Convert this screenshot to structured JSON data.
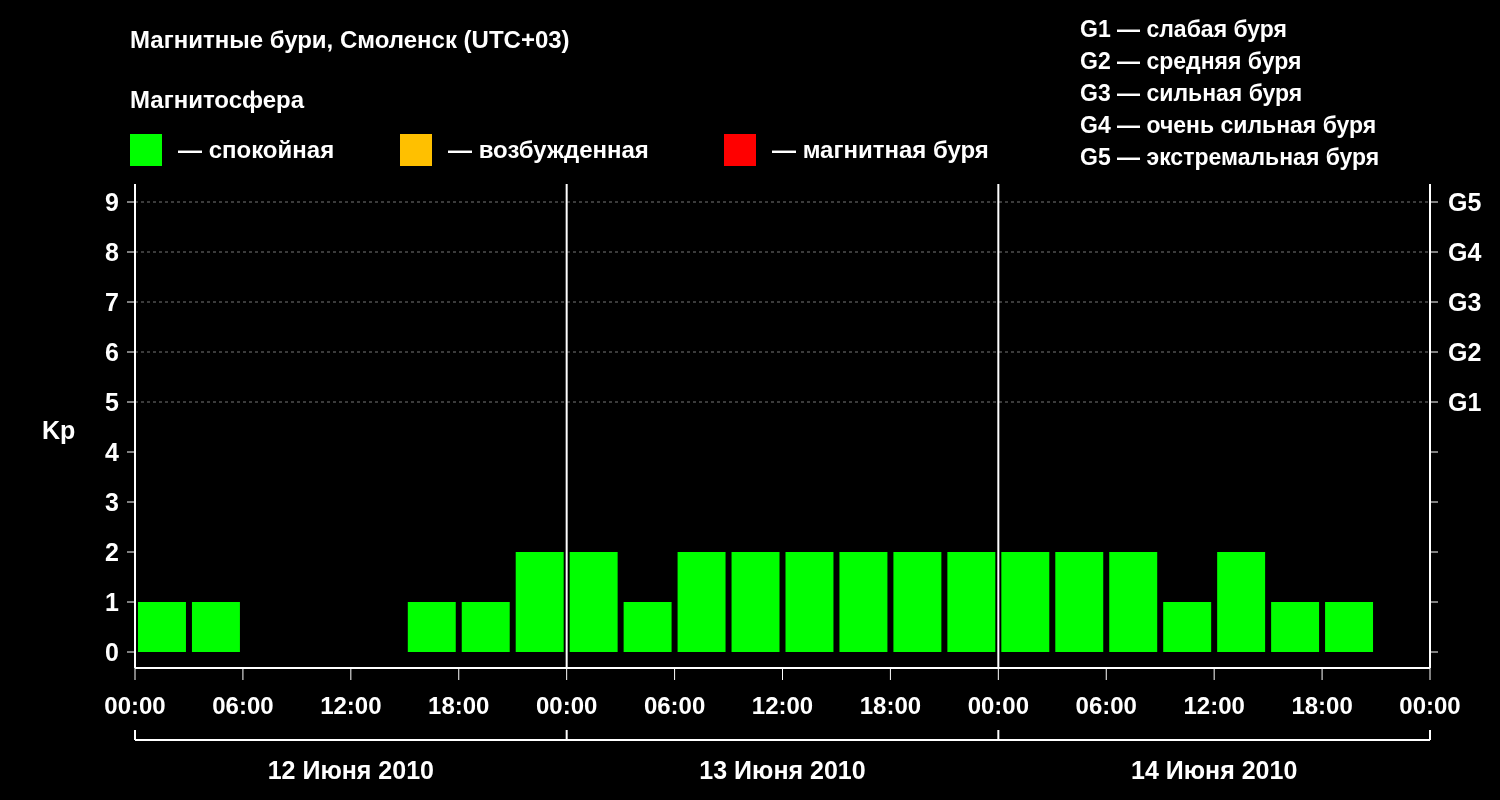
{
  "title": "Магнитные бури, Смоленск (UTC+03)",
  "legend": {
    "title": "Магнитосфера",
    "items": [
      {
        "label": "— спокойная",
        "color": "#00ff00"
      },
      {
        "label": "— возбужденная",
        "color": "#ffc000"
      },
      {
        "label": "— магнитная буря",
        "color": "#ff0000"
      }
    ]
  },
  "scale": [
    "G1 — слабая буря",
    "G2 — средняя буря",
    "G3 — сильная буря",
    "G4 — очень сильная буря",
    "G5 — экстремальная буря"
  ],
  "chart": {
    "chart_data": {
      "type": "bar",
      "ylabel": "Kp",
      "grid": true,
      "series": [
        {
          "color": "#00ff00",
          "values": [
            1,
            1,
            null,
            null,
            null,
            1,
            1,
            2,
            2,
            1,
            2,
            2,
            2,
            2,
            2,
            2,
            2,
            2,
            2,
            1,
            2,
            1,
            1,
            null
          ]
        }
      ],
      "ylim": [
        -0.32,
        9.36
      ],
      "yticks": [
        0,
        1,
        2,
        3,
        4,
        5,
        6,
        7,
        8,
        9
      ]
    },
    "right_labels": [
      "G5",
      "G4",
      "G3",
      "G2",
      "G1"
    ],
    "time_labels": [
      "00:00",
      "06:00",
      "12:00",
      "18:00",
      "00:00",
      "06:00",
      "12:00",
      "18:00",
      "00:00",
      "06:00",
      "12:00",
      "18:00",
      "00:00"
    ],
    "days": [
      "12 Июня 2010",
      "13 Июня 2010",
      "14 Июня 2010"
    ]
  }
}
